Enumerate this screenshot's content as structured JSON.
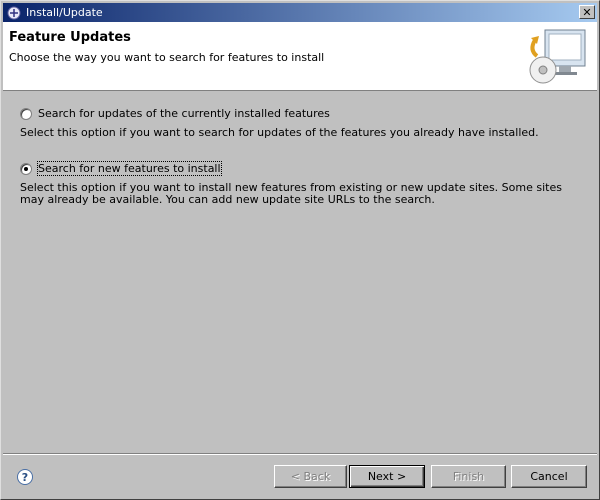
{
  "window": {
    "title": "Install/Update",
    "close_glyph": "✕",
    "icon": "eclipse-install-icon"
  },
  "banner": {
    "title": "Feature Updates",
    "description": "Choose the way you want to search for features to install",
    "graphic": "install-wizard-graphic"
  },
  "options": [
    {
      "label": "Search for updates of the currently installed features",
      "description": "Select this option if you want to search for updates of the features you already have installed.",
      "selected": false
    },
    {
      "label": "Search for new features to install",
      "description": "Select this option if you want to install new features from existing or new update sites. Some sites may already be available. You can add new update site URLs to the search.",
      "selected": true
    }
  ],
  "footer": {
    "help_glyph": "?",
    "back_label": "< Back",
    "next_label": "Next >",
    "finish_label": "Finish",
    "cancel_label": "Cancel"
  },
  "colors": {
    "titlebar_start": "#0a246a",
    "titlebar_end": "#a6caf0",
    "dialog_bg": "#c0c0c0",
    "banner_bg": "#ffffff"
  }
}
